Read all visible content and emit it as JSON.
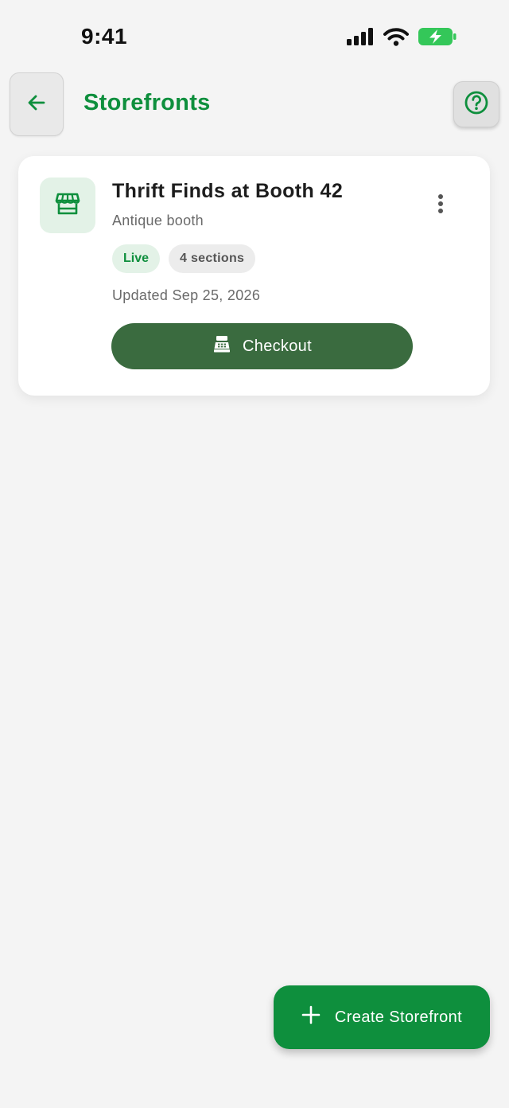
{
  "status_bar": {
    "time": "9:41",
    "icons": [
      "cellular-signal-icon",
      "wifi-icon",
      "battery-charging-icon"
    ],
    "battery_color": "#34c759"
  },
  "header": {
    "title": "Storefronts",
    "back_icon": "arrow-left-icon",
    "help_icon": "help-circle-icon",
    "accent_color": "#0e8f3d"
  },
  "storefronts": [
    {
      "icon": "storefront-icon",
      "name": "Thrift Finds at Booth 42",
      "type": "Antique booth",
      "status_badge": "Live",
      "sections_badge": "4 sections",
      "updated": "Updated Sep 25, 2026",
      "action_label": "Checkout",
      "action_icon": "cash-register-icon",
      "menu_icon": "more-vertical-icon"
    }
  ],
  "fab": {
    "icon": "plus-icon",
    "label": "Create Storefront"
  }
}
